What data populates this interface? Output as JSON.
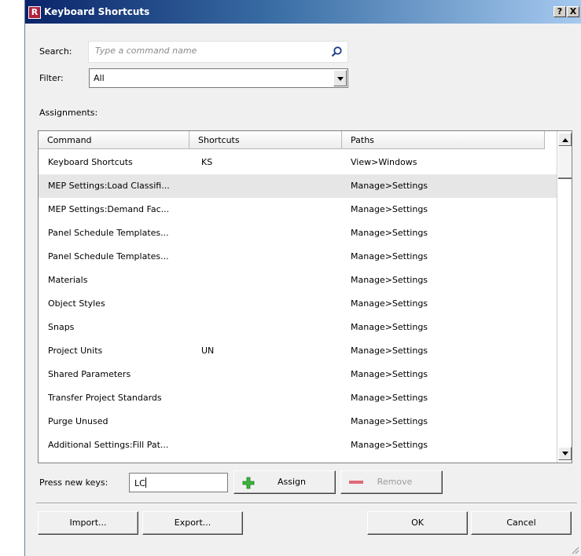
{
  "window": {
    "title": "Keyboard Shortcuts",
    "help_label": "?",
    "close_label": "X",
    "app_icon_label": "R"
  },
  "search": {
    "label": "Search:",
    "placeholder": "Type a command name"
  },
  "filter": {
    "label": "Filter:",
    "value": "All"
  },
  "assignments_label": "Assignments:",
  "table": {
    "columns": [
      "Command",
      "Shortcuts",
      "Paths"
    ],
    "rows": [
      {
        "command": "Keyboard Shortcuts",
        "shortcut": "KS",
        "path": "View>Windows"
      },
      {
        "command": "MEP Settings:Load Classifi...",
        "shortcut": "",
        "path": "Manage>Settings"
      },
      {
        "command": "MEP Settings:Demand Fac...",
        "shortcut": "",
        "path": "Manage>Settings"
      },
      {
        "command": "Panel Schedule Templates...",
        "shortcut": "",
        "path": "Manage>Settings"
      },
      {
        "command": "Panel Schedule Templates...",
        "shortcut": "",
        "path": "Manage>Settings"
      },
      {
        "command": "Materials",
        "shortcut": "",
        "path": "Manage>Settings"
      },
      {
        "command": "Object Styles",
        "shortcut": "",
        "path": "Manage>Settings"
      },
      {
        "command": "Snaps",
        "shortcut": "",
        "path": "Manage>Settings"
      },
      {
        "command": "Project Units",
        "shortcut": "UN",
        "path": "Manage>Settings"
      },
      {
        "command": "Shared Parameters",
        "shortcut": "",
        "path": "Manage>Settings"
      },
      {
        "command": "Transfer Project Standards",
        "shortcut": "",
        "path": "Manage>Settings"
      },
      {
        "command": "Purge Unused",
        "shortcut": "",
        "path": "Manage>Settings"
      },
      {
        "command": "Additional Settings:Fill Pat...",
        "shortcut": "",
        "path": "Manage>Settings"
      }
    ]
  },
  "press_keys": {
    "label": "Press new keys:",
    "value": "LC"
  },
  "buttons": {
    "assign": "Assign",
    "remove": "Remove",
    "import": "Import...",
    "export": "Export...",
    "ok": "OK",
    "cancel": "Cancel"
  },
  "colors": {
    "title_gradient_start": "#0a246a",
    "assign_icon": "#3cb43c",
    "remove_icon": "#e06a7a",
    "selected_row": "#e6e6e6"
  }
}
